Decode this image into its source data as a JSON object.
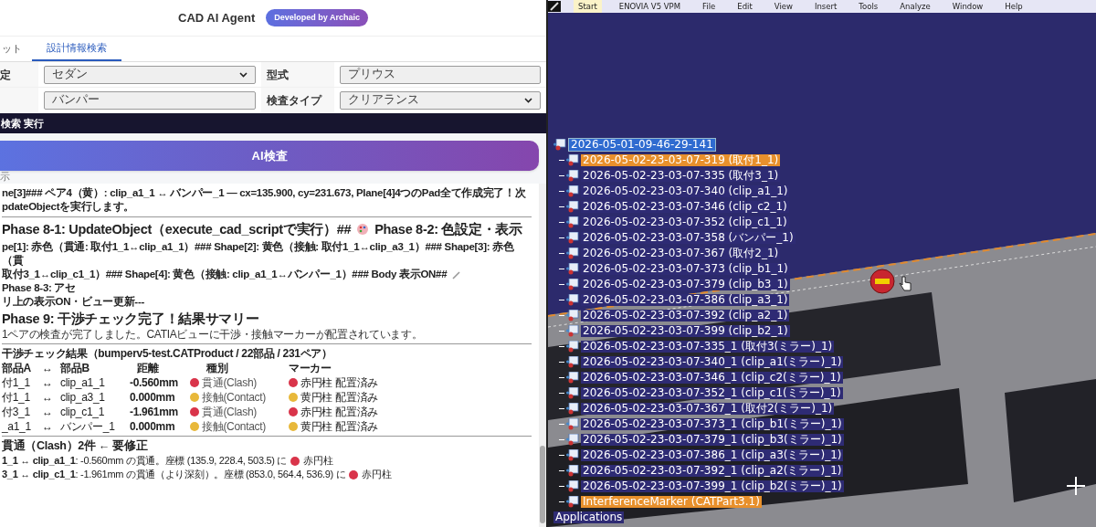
{
  "app_header": {
    "title": "CAD AI Agent",
    "badge": "Developed by Archaic"
  },
  "tabs": [
    {
      "label": "ット",
      "selected": false
    },
    {
      "label": "設計情報検索",
      "selected": true
    }
  ],
  "form": {
    "rows": [
      {
        "label_1": "定",
        "field_1": {
          "kind": "select",
          "value": "セダン"
        },
        "label_2": "型式",
        "field_2": {
          "kind": "input",
          "value": "プリウス"
        }
      },
      {
        "label_1": "",
        "field_1": {
          "kind": "input",
          "value": "バンパー"
        },
        "label_2": "検査タイプ",
        "field_2": {
          "kind": "select",
          "value": "クリアランス"
        }
      }
    ]
  },
  "section_bar": "検索 実行",
  "ai_button": "AI検査",
  "section_label": "示",
  "log": {
    "intro_lines": [
      "ne[3]### ペア4（黄）: clip_a1_1 ↔ バンパー_1 — cx=135.900, cy=231.673, Plane[4]4つのPad全て作成完了！次",
      "pdateObjectを実行します。"
    ],
    "heading_1": {
      "before": "Phase 8-1: UpdateObject（execute_cad_scriptで実行）##",
      "after": "Phase 8-2: 色設定・表示"
    },
    "shape_lines": [
      "pe[1]: 赤色（貫通: 取付1_1↔clip_a1_1）### Shape[2]: 黄色（接触: 取付1_1↔clip_a3_1）### Shape[3]: 赤色（貫",
      "取付3_1↔clip_c1_1）### Shape[4]: 黄色（接触: clip_a1_1↔バンパー_1）### Body 表示ON##",
      "Phase 8-3: アセ",
      "リ上の表示ON・ビュー更新---"
    ],
    "heading_2": "Phase 9: 干渉チェック完了！結果サマリー",
    "note": "1ペアの検査が完了しました。CATIAビューに干渉・接触マーカーが配置されています。",
    "result_title": "干渉チェック結果（bumperv5-test.CATProduct / 22部品 / 231ペア）",
    "columns": [
      "部品A",
      "↔",
      "部品B",
      "距離",
      "種別",
      "マーカー"
    ],
    "rows": [
      {
        "part_a": "付1_1",
        "arrow": "↔",
        "part_b": "clip_a1_1",
        "distance": "-0.560mm",
        "kind": "clash",
        "type": "貫通(Clash)",
        "marker": "赤円柱 配置済み"
      },
      {
        "part_a": "付1_1",
        "arrow": "↔",
        "part_b": "clip_a3_1",
        "distance": "0.000mm",
        "kind": "contact",
        "type": "接触(Contact)",
        "marker": "黄円柱 配置済み"
      },
      {
        "part_a": "付3_1",
        "arrow": "↔",
        "part_b": "clip_c1_1",
        "distance": "-1.961mm",
        "kind": "clash",
        "type": "貫通(Clash)",
        "marker": "赤円柱 配置済み"
      },
      {
        "part_a": "_a1_1",
        "arrow": "↔",
        "part_b": "バンパー_1",
        "distance": "0.000mm",
        "kind": "contact",
        "type": "接触(Contact)",
        "marker": "黄円柱 配置済み"
      }
    ],
    "clash_title": "貫通（Clash）2件 ← 要修正",
    "clash_items": [
      {
        "text": "**1_1 ↔ clip_a1_1**: -0.560mm の貫通。座標 (135.9, 228.4, 503.5) に",
        "kind": "clash",
        "marker": "赤円柱"
      },
      {
        "text": "**3_1 ↔ clip_c1_1**: -1.961mm の貫通（より深刻）。座標 (853.0, 564.4, 536.9) に",
        "kind": "clash",
        "marker": "赤円柱"
      }
    ]
  },
  "catia": {
    "menu": [
      {
        "label": "Start",
        "selected": true
      },
      {
        "label": "ENOVIA V5 VPM",
        "selected": false
      },
      {
        "label": "File",
        "selected": false
      },
      {
        "label": "Edit",
        "selected": false
      },
      {
        "label": "View",
        "selected": false
      },
      {
        "label": "Insert",
        "selected": false
      },
      {
        "label": "Tools",
        "selected": false
      },
      {
        "label": "Analyze",
        "selected": false
      },
      {
        "label": "Window",
        "selected": false
      },
      {
        "label": "Help",
        "selected": false
      }
    ],
    "tree": {
      "root": {
        "label": "2026-05-01-09-46-29-141",
        "selected": true
      },
      "children": [
        {
          "label": "2026-05-02-23-03-07-319 (取付1_1)",
          "selected": true
        },
        {
          "label": "2026-05-02-23-03-07-335 (取付3_1)",
          "selected": false
        },
        {
          "label": "2026-05-02-23-03-07-340 (clip_a1_1)",
          "selected": false
        },
        {
          "label": "2026-05-02-23-03-07-346 (clip_c2_1)",
          "selected": false
        },
        {
          "label": "2026-05-02-23-03-07-352 (clip_c1_1)",
          "selected": false
        },
        {
          "label": "2026-05-02-23-03-07-358 (バンパー_1)",
          "selected": false
        },
        {
          "label": "2026-05-02-23-03-07-367 (取付2_1)",
          "selected": false
        },
        {
          "label": "2026-05-02-23-03-07-373 (clip_b1_1)",
          "selected": false
        },
        {
          "label": "2026-05-02-23-03-07-379 (clip_b3_1)",
          "selected": false
        },
        {
          "label": "2026-05-02-23-03-07-386 (clip_a3_1)",
          "selected": false
        },
        {
          "label": "2026-05-02-23-03-07-392 (clip_a2_1)",
          "selected": false
        },
        {
          "label": "2026-05-02-23-03-07-399 (clip_b2_1)",
          "selected": false
        },
        {
          "label": "2026-05-02-23-03-07-335_1 (取付3(ミラー)_1)",
          "selected": false
        },
        {
          "label": "2026-05-02-23-03-07-340_1 (clip_a1(ミラー)_1)",
          "selected": false
        },
        {
          "label": "2026-05-02-23-03-07-346_1 (clip_c2(ミラー)_1)",
          "selected": false
        },
        {
          "label": "2026-05-02-23-03-07-352_1 (clip_c1(ミラー)_1)",
          "selected": false
        },
        {
          "label": "2026-05-02-23-03-07-367_1 (取付2(ミラー)_1)",
          "selected": false
        },
        {
          "label": "2026-05-02-23-03-07-373_1 (clip_b1(ミラー)_1)",
          "selected": false
        },
        {
          "label": "2026-05-02-23-03-07-379_1 (clip_b3(ミラー)_1)",
          "selected": false
        },
        {
          "label": "2026-05-02-23-03-07-386_1 (clip_a3(ミラー)_1)",
          "selected": false
        },
        {
          "label": "2026-05-02-23-03-07-392_1 (clip_a2(ミラー)_1)",
          "selected": false
        },
        {
          "label": "2026-05-02-23-03-07-399_1 (clip_b2(ミラー)_1)",
          "selected": false
        },
        {
          "label": "InterferenceMarker (CATPart3.1)",
          "selected": true
        }
      ],
      "footer": "Applications"
    }
  }
}
